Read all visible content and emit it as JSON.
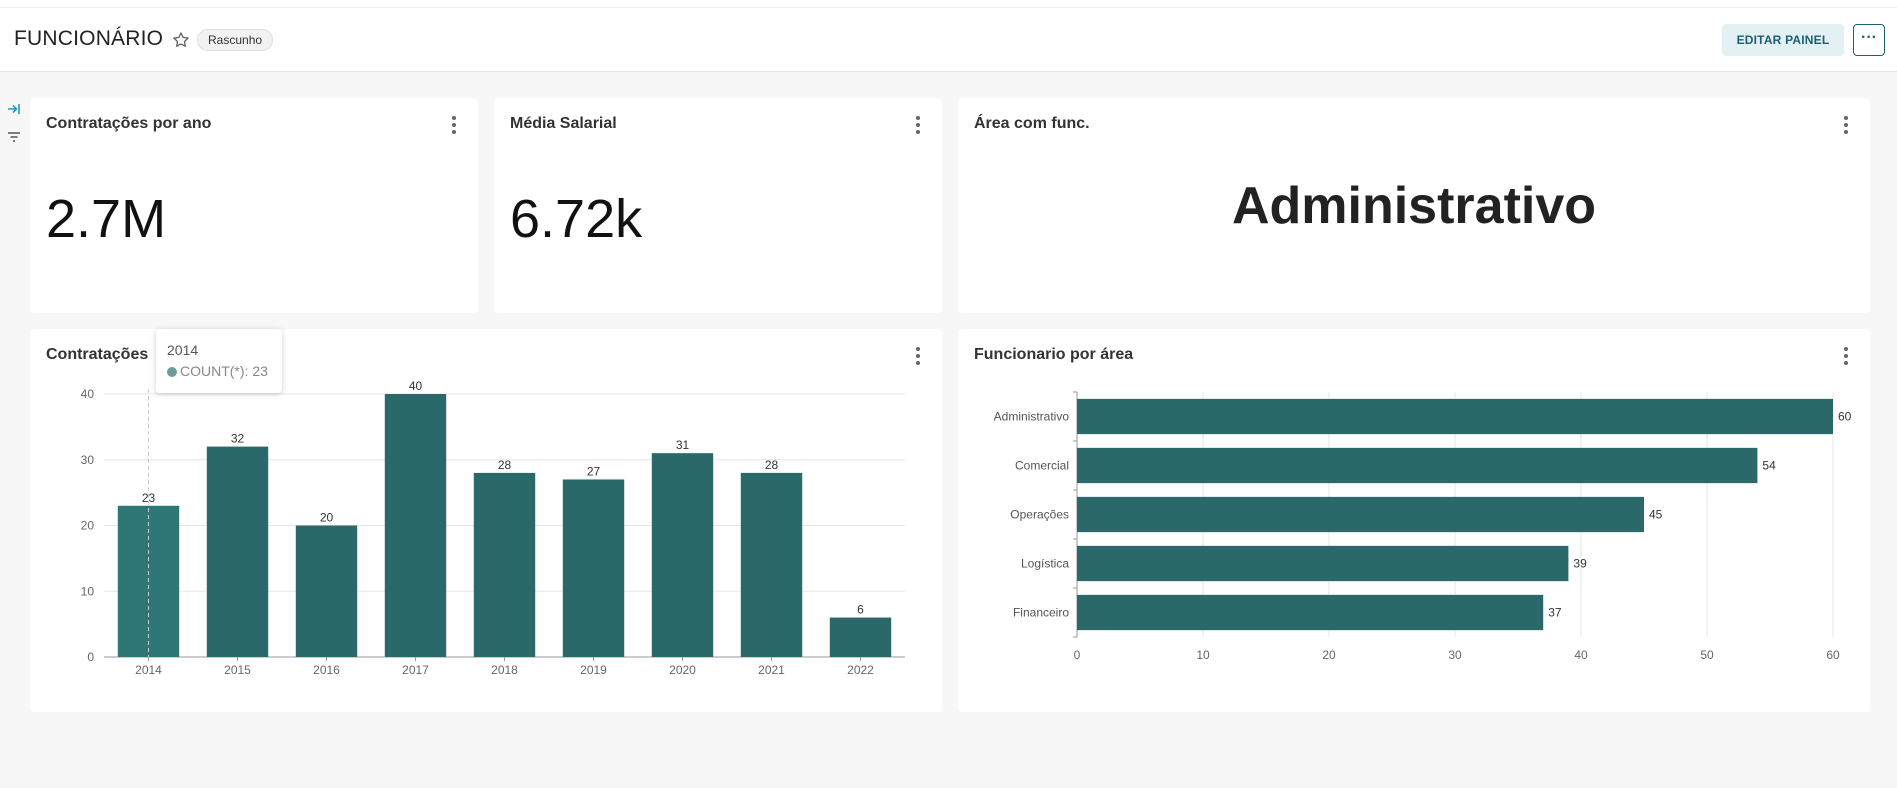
{
  "header": {
    "title": "FUNCIONÁRIO",
    "badge": "Rascunho",
    "edit_label": "EDITAR PAINEL",
    "more_label": "···"
  },
  "cards": {
    "hires_per_year": {
      "title": "Contratações por ano",
      "value": "2.7M"
    },
    "avg_salary": {
      "title": "Média Salarial",
      "value": "6.72k"
    },
    "area": {
      "title": "Área com func.",
      "value": "Administrativo"
    },
    "hires_chart": {
      "title": "Contratações"
    },
    "employees_by_area": {
      "title": "Funcionario por área"
    }
  },
  "tooltip": {
    "title": "2014",
    "series": "COUNT(*): 23"
  },
  "colors": {
    "bar": "#2a6869",
    "bar_hover": "#2f7776",
    "accent": "#1c5e74"
  },
  "chart_data": [
    {
      "type": "bar",
      "title": "Contratações",
      "categories": [
        "2014",
        "2015",
        "2016",
        "2017",
        "2018",
        "2019",
        "2020",
        "2021",
        "2022"
      ],
      "values": [
        23,
        32,
        20,
        40,
        28,
        27,
        31,
        28,
        6
      ],
      "ylim": [
        0,
        40
      ],
      "yticks": [
        0,
        10,
        20,
        30,
        40
      ],
      "grid": true,
      "data_labels": true
    },
    {
      "type": "bar",
      "orientation": "horizontal",
      "title": "Funcionario por área",
      "categories": [
        "Administrativo",
        "Comercial",
        "Operações",
        "Logística",
        "Financeiro"
      ],
      "values": [
        60,
        54,
        45,
        39,
        37
      ],
      "xlim": [
        0,
        60
      ],
      "xticks": [
        0,
        10,
        20,
        30,
        40,
        50,
        60
      ],
      "grid": true,
      "data_labels": true
    }
  ]
}
